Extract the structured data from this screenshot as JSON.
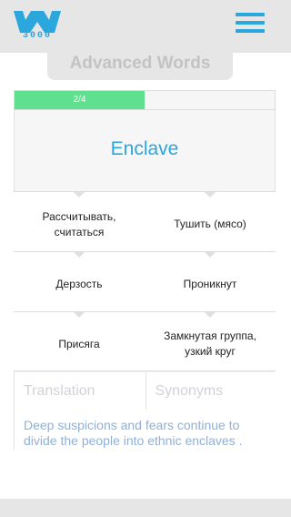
{
  "logo": {
    "text": "3000",
    "icon": "w-logo-icon"
  },
  "menu": {
    "icon": "hamburger-menu-icon"
  },
  "page": {
    "title": "Advanced Words"
  },
  "progress": {
    "label": "2/4",
    "fraction": 0.5
  },
  "word": "Enclave",
  "options": [
    [
      "Рассчитывать, считаться",
      "Тушить (мясо)"
    ],
    [
      "Дерзость",
      "Проникнут"
    ],
    [
      "Присяга",
      "Замкнутая группа, узкий круг"
    ]
  ],
  "tabs": {
    "translation": "Translation",
    "synonyms": "Synonyms"
  },
  "example": "Deep suspicions and fears continue to divide the people into ethnic enclaves .",
  "colors": {
    "accent": "#2aa7dc",
    "progress": "#5ee08f",
    "example_text": "#8fb0d8"
  }
}
